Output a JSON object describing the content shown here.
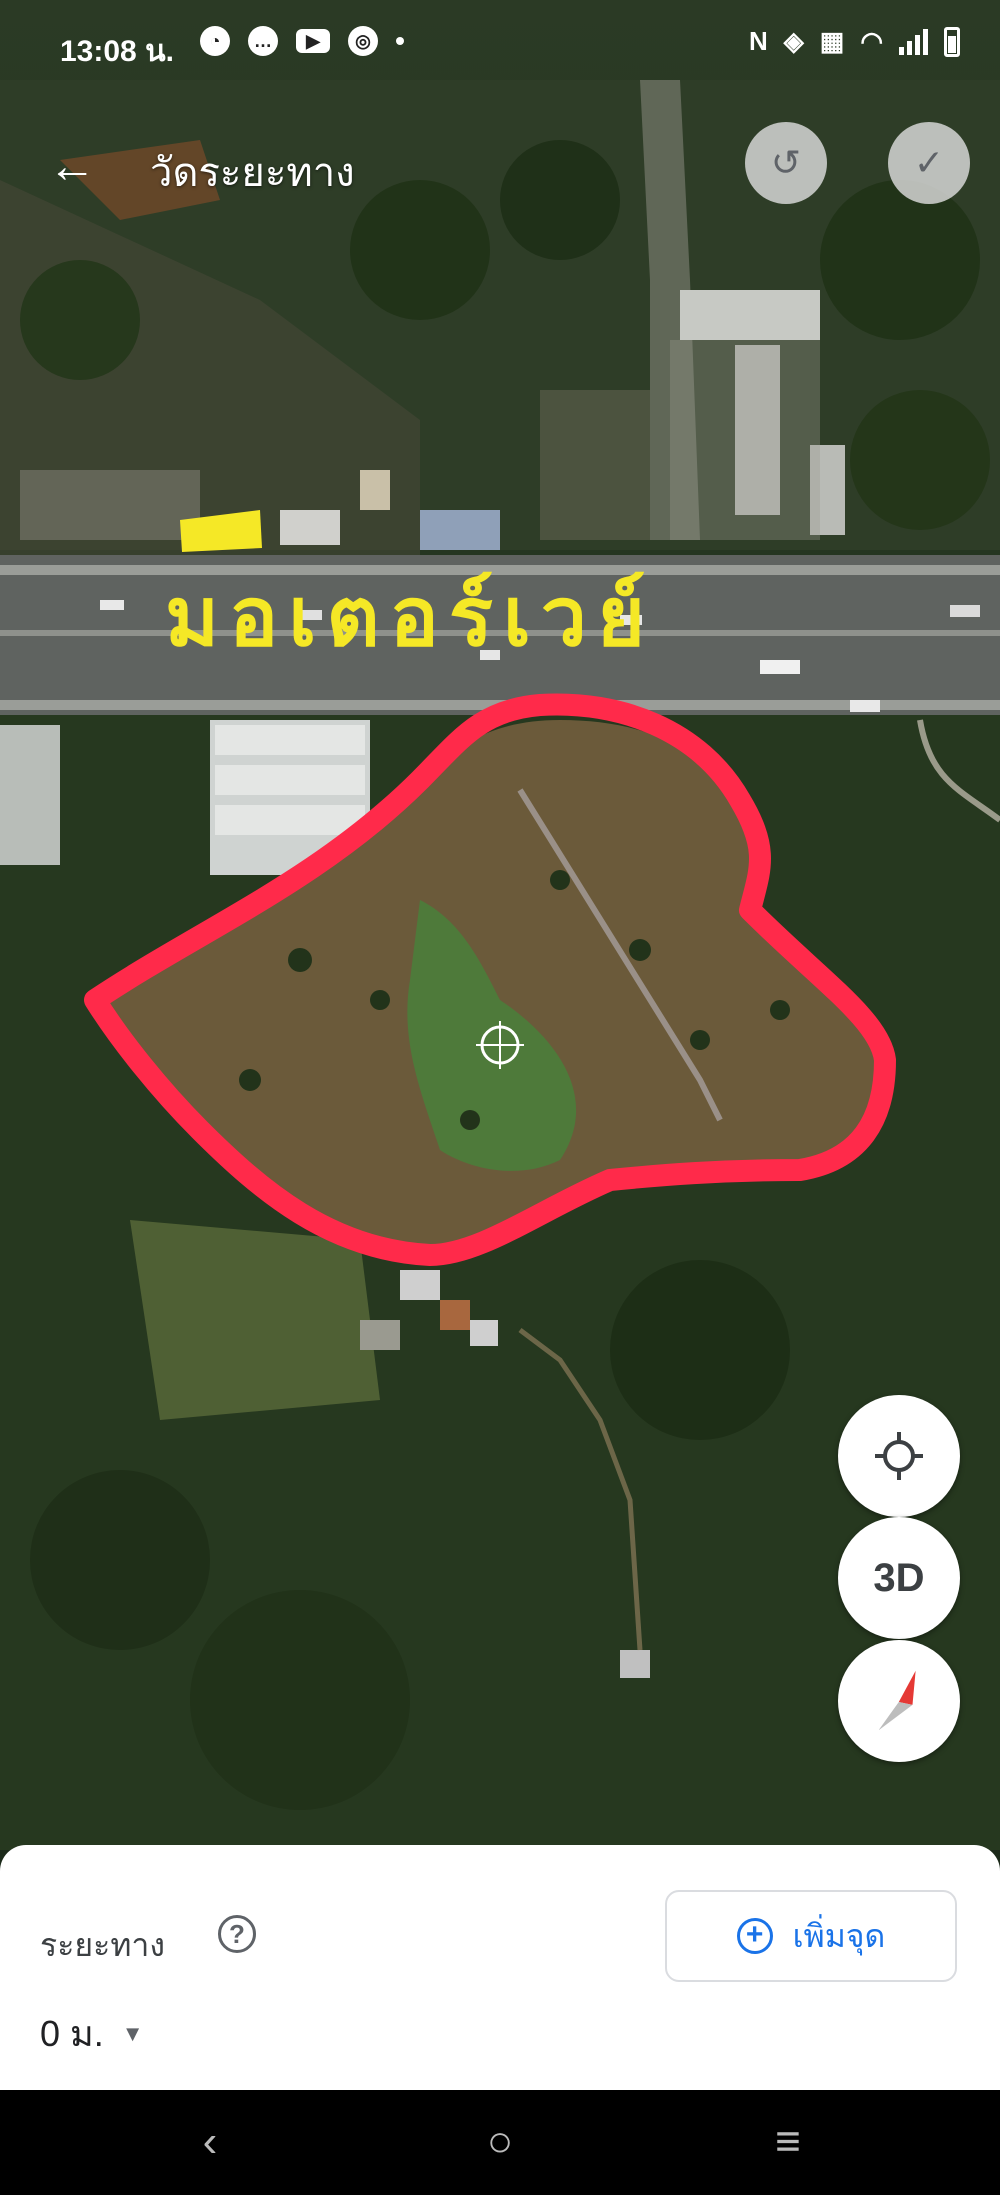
{
  "status_bar": {
    "time": "13:08 น.",
    "network_label": "N"
  },
  "app_bar": {
    "title": "วัดระยะทาง",
    "back_icon": "arrow-back-icon",
    "undo_icon": "undo-icon",
    "done_icon": "check-icon"
  },
  "map": {
    "handwritten_label": "มอเตอร์เวย์",
    "highlight_color": "#ff2a4a",
    "label_color": "#f5e826"
  },
  "controls": {
    "location_icon": "my-location-icon",
    "three_d_label": "3D",
    "compass_icon": "compass-icon"
  },
  "bottom_sheet": {
    "distance_label": "ระยะทาง",
    "distance_value": "0 ม.",
    "add_point_label": "เพิ่มจุด"
  },
  "nav_bar": {
    "back_icon": "nav-back-icon",
    "home_icon": "nav-home-icon",
    "recents_icon": "nav-recents-icon"
  }
}
